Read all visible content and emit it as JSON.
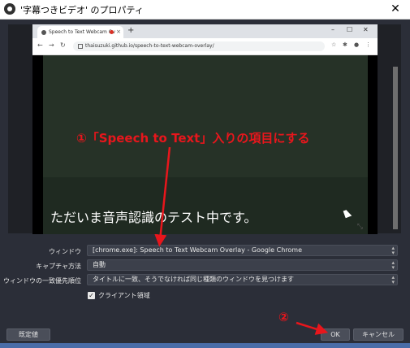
{
  "window": {
    "title": "'字幕つきビデオ' のプロパティ",
    "close_glyph": "✕"
  },
  "browser": {
    "tab_title": "Speech to Text Webcam Ov",
    "tab_close_glyph": "×",
    "new_tab_glyph": "+",
    "minimize_glyph": "–",
    "maximize_glyph": "☐",
    "window_close_glyph": "✕",
    "back_glyph": "←",
    "forward_glyph": "→",
    "reload_glyph": "↻",
    "url": "thaisuzuki.github.io/speech-to-text-webcam-overlay/",
    "icons": [
      "star-icon",
      "puzzle-icon",
      "profile-icon",
      "menu-icon"
    ]
  },
  "preview": {
    "caption": "ただいま音声認識のテスト中です。"
  },
  "annotations": {
    "step1": "①「Speech to Text」入りの項目にする",
    "step2": "②",
    "color": "#e8161c"
  },
  "form": {
    "window_label": "ウィンドウ",
    "window_value": "[chrome.exe]: Speech to Text Webcam Overlay - Google Chrome",
    "capture_label": "キャプチャ方法",
    "capture_value": "自動",
    "priority_label": "ウィンドウの一致優先順位",
    "priority_value": "タイトルに一致、そうでなければ同じ種類のウィンドウを見つけます",
    "client_area_label": "クライアント領域",
    "client_area_checked": true
  },
  "buttons": {
    "defaults": "既定値",
    "ok": "OK",
    "cancel": "キャンセル"
  }
}
